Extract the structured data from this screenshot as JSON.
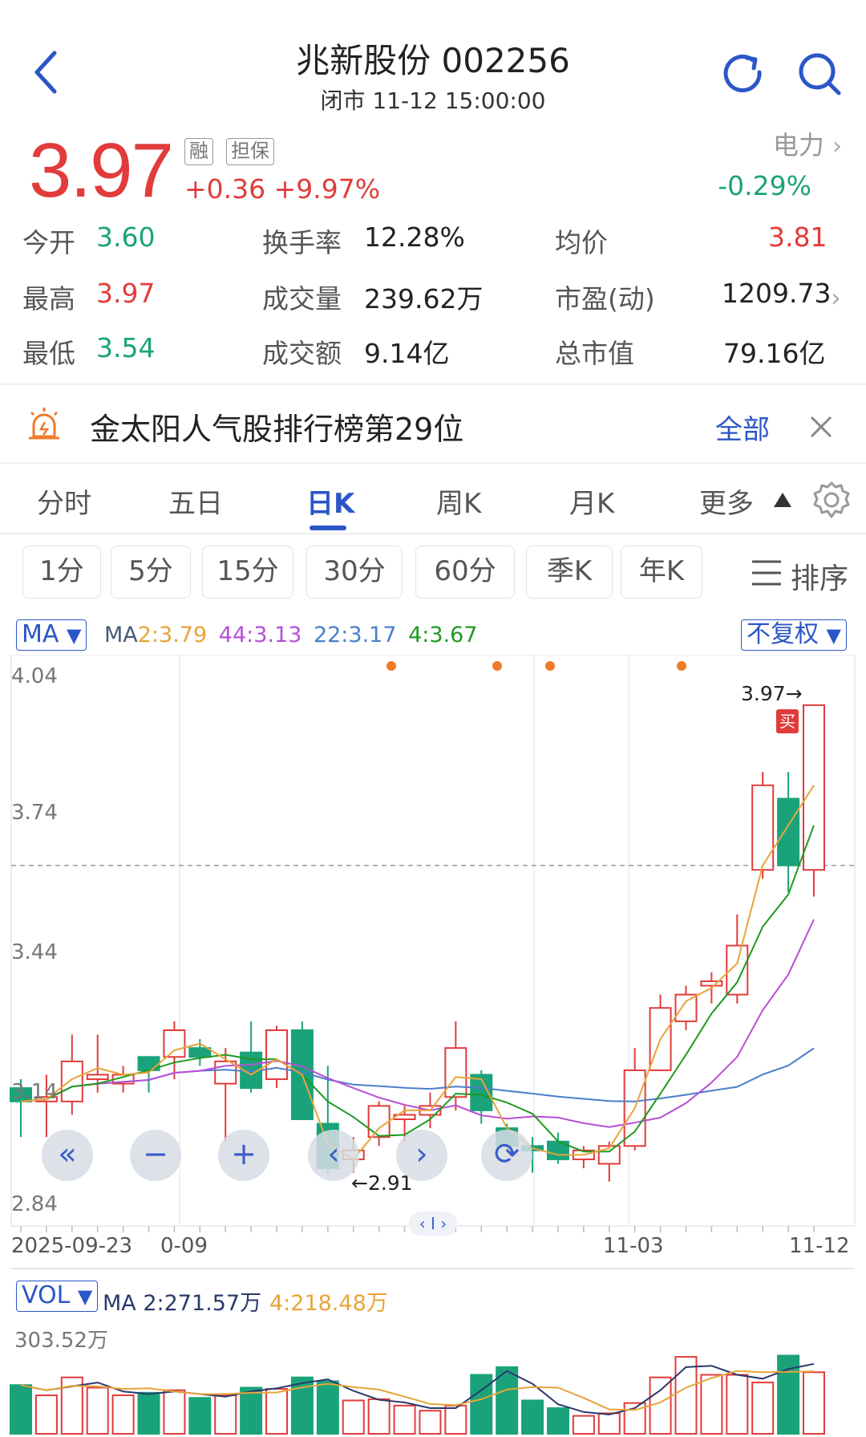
{
  "header": {
    "title": "兆新股份 002256",
    "subtitle": "闭市 11-12 15:00:00"
  },
  "quote": {
    "price": "3.97",
    "tag_margin": "融",
    "tag_guarantee": "担保",
    "change": "+0.36",
    "change_pct": "+9.97%",
    "sector_name": "电力",
    "sector_change": "-0.29%",
    "color_up": "#e23b3b",
    "color_down": "#1aa37a"
  },
  "stats": {
    "open_label": "今开",
    "open_value": "3.60",
    "high_label": "最高",
    "high_value": "3.97",
    "low_label": "最低",
    "low_value": "3.54",
    "turnover_label": "换手率",
    "turnover_value": "12.28%",
    "volume_label": "成交量",
    "volume_value": "239.62万",
    "amount_label": "成交额",
    "amount_value": "9.14亿",
    "avg_label": "均价",
    "avg_value": "3.81",
    "pe_label": "市盈(动)",
    "pe_value": "1209.73",
    "mcap_label": "总市值",
    "mcap_value": "79.16亿"
  },
  "banner": {
    "text": "金太阳人气股排行榜第29位",
    "all_label": "全部"
  },
  "tabs": [
    "分时",
    "五日",
    "日K",
    "周K",
    "月K",
    "更多"
  ],
  "active_tab": "日K",
  "periods": [
    "1分",
    "5分",
    "15分",
    "30分",
    "60分",
    "季K",
    "年K"
  ],
  "sort_label": "排序",
  "chart": {
    "indicator_label": "MA",
    "adjust_label": "不复权",
    "ma_legend": {
      "prefix": "MA",
      "ma2": "2:3.79",
      "ma44": "44:3.13",
      "ma22": "22:3.17",
      "ma4": "4:3.67"
    },
    "y_top": "4.04",
    "y_mid_high": "3.74",
    "y_mid": "3.44",
    "y_low": "3.14",
    "y_bottom": "2.84",
    "x_start": "2025-09-23",
    "x_mid1": "0-09",
    "x_mid2": "11-03",
    "x_end": "11-12",
    "max_label": "3.97",
    "min_label": "2.91",
    "buy_tag": "买",
    "vol_indicator": "VOL",
    "vol_ma2": "MA 2:271.57万",
    "vol_ma4": "4:218.48万",
    "vol_top": "303.52万",
    "colors": {
      "up": "#e23b3b",
      "down": "#1aa37a",
      "ma2": "#e8a43a",
      "ma44": "#b84fd6",
      "ma22": "#4a7fc9",
      "ma4": "#1f9a1f"
    }
  },
  "chart_data": {
    "type": "candlestick",
    "x_labels": [
      "2025-09-23",
      "0-09",
      "11-03",
      "11-12"
    ],
    "ylim": [
      2.84,
      4.04
    ],
    "candles": [
      {
        "o": 3.11,
        "c": 3.08,
        "h": 3.13,
        "l": 3.0
      },
      {
        "o": 3.08,
        "c": 3.09,
        "h": 3.14,
        "l": 3.0
      },
      {
        "o": 3.08,
        "c": 3.17,
        "h": 3.23,
        "l": 3.05
      },
      {
        "o": 3.13,
        "c": 3.14,
        "h": 3.23,
        "l": 3.1
      },
      {
        "o": 3.12,
        "c": 3.14,
        "h": 3.16,
        "l": 3.1
      },
      {
        "o": 3.18,
        "c": 3.15,
        "h": 3.18,
        "l": 3.1
      },
      {
        "o": 3.18,
        "c": 3.24,
        "h": 3.26,
        "l": 3.13
      },
      {
        "o": 3.2,
        "c": 3.18,
        "h": 3.22,
        "l": 3.16
      },
      {
        "o": 3.12,
        "c": 3.17,
        "h": 3.2,
        "l": 2.99
      },
      {
        "o": 3.19,
        "c": 3.11,
        "h": 3.26,
        "l": 3.1
      },
      {
        "o": 3.13,
        "c": 3.24,
        "h": 3.25,
        "l": 3.11
      },
      {
        "o": 3.24,
        "c": 3.04,
        "h": 3.26,
        "l": 3.04
      },
      {
        "o": 3.03,
        "c": 2.93,
        "h": 3.16,
        "l": 2.92
      },
      {
        "o": 2.95,
        "c": 2.97,
        "h": 3.0,
        "l": 2.92
      },
      {
        "o": 3.0,
        "c": 3.07,
        "h": 3.08,
        "l": 2.98
      },
      {
        "o": 3.04,
        "c": 3.05,
        "h": 3.07,
        "l": 2.99
      },
      {
        "o": 3.05,
        "c": 3.07,
        "h": 3.1,
        "l": 3.02
      },
      {
        "o": 3.09,
        "c": 3.2,
        "h": 3.26,
        "l": 3.06
      },
      {
        "o": 3.14,
        "c": 3.06,
        "h": 3.15,
        "l": 3.03
      },
      {
        "o": 3.02,
        "c": 2.98,
        "h": 3.03,
        "l": 2.97
      },
      {
        "o": 2.98,
        "c": 2.97,
        "h": 3.0,
        "l": 2.92
      },
      {
        "o": 2.99,
        "c": 2.95,
        "h": 3.01,
        "l": 2.94
      },
      {
        "o": 2.95,
        "c": 2.97,
        "h": 2.98,
        "l": 2.93
      },
      {
        "o": 2.94,
        "c": 2.98,
        "h": 2.99,
        "l": 2.9
      },
      {
        "o": 2.98,
        "c": 3.15,
        "h": 3.2,
        "l": 2.97
      },
      {
        "o": 3.15,
        "c": 3.29,
        "h": 3.32,
        "l": 3.15
      },
      {
        "o": 3.26,
        "c": 3.32,
        "h": 3.34,
        "l": 3.24
      },
      {
        "o": 3.34,
        "c": 3.35,
        "h": 3.37,
        "l": 3.3
      },
      {
        "o": 3.32,
        "c": 3.43,
        "h": 3.5,
        "l": 3.3
      },
      {
        "o": 3.6,
        "c": 3.79,
        "h": 3.82,
        "l": 3.58
      },
      {
        "o": 3.76,
        "c": 3.61,
        "h": 3.82,
        "l": 3.55
      },
      {
        "o": 3.6,
        "c": 3.97,
        "h": 3.97,
        "l": 3.54
      }
    ],
    "volume": {
      "ylim": [
        0,
        303.52
      ],
      "values": [
        190,
        150,
        220,
        180,
        150,
        160,
        170,
        140,
        150,
        180,
        175,
        220,
        205,
        130,
        135,
        110,
        90,
        110,
        230,
        260,
        130,
        100,
        70,
        80,
        120,
        220,
        300,
        230,
        230,
        200,
        305,
        240
      ]
    }
  }
}
